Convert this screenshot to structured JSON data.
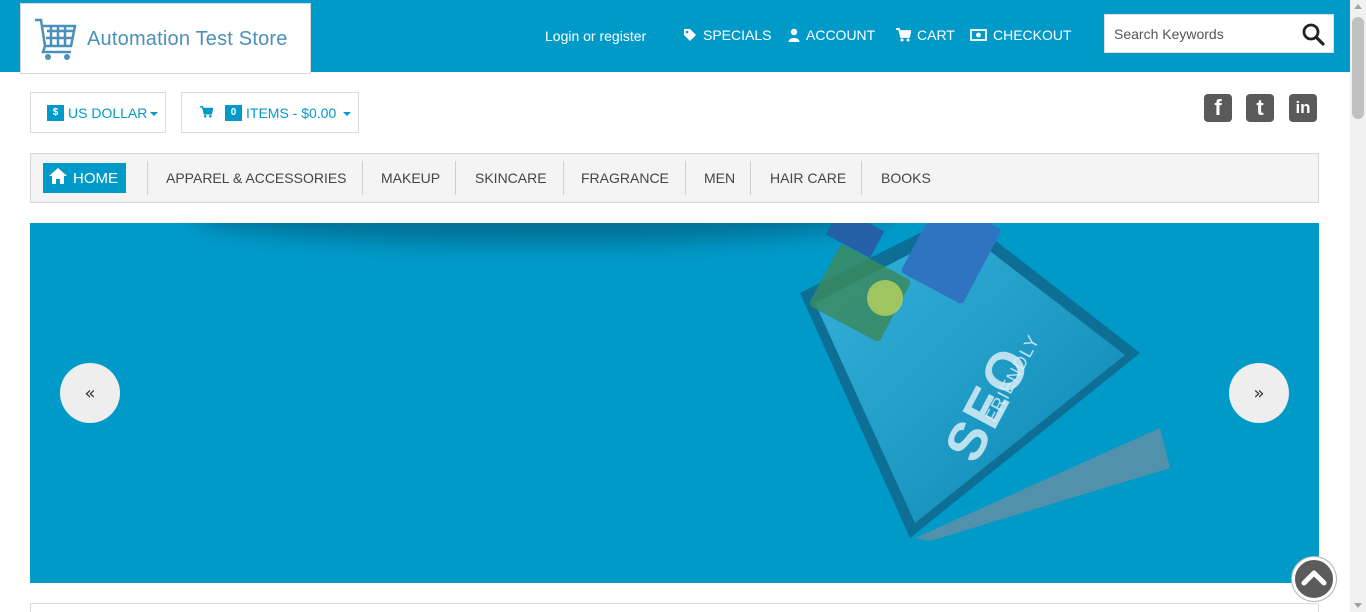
{
  "brand": {
    "name": "Automation Test Store"
  },
  "header": {
    "login_label": "Login or register",
    "nav": [
      {
        "label": "SPECIALS",
        "icon": "tag-icon"
      },
      {
        "label": "ACCOUNT",
        "icon": "user-icon"
      },
      {
        "label": "CART",
        "icon": "cart-icon"
      },
      {
        "label": "CHECKOUT",
        "icon": "money-icon"
      }
    ],
    "search": {
      "placeholder": "Search Keywords",
      "value": "",
      "icon": "search-icon"
    }
  },
  "toolbar": {
    "currency_symbol": "$",
    "currency_label": "US DOLLAR",
    "cart_count": "0",
    "cart_label": "ITEMS - $0.00"
  },
  "social": [
    {
      "name": "facebook",
      "glyph": "f"
    },
    {
      "name": "twitter",
      "glyph": "t"
    },
    {
      "name": "linkedin",
      "glyph": "in"
    }
  ],
  "menu": {
    "home_label": "HOME",
    "items": [
      "APPAREL & ACCESSORIES",
      "MAKEUP",
      "SKINCARE",
      "FRAGRANCE",
      "MEN",
      "HAIR CARE",
      "BOOKS"
    ]
  },
  "banner": {
    "prev_glyph": "«",
    "next_glyph": "»",
    "device_text_main": "SEO",
    "device_text_sub": "FRIENDLY"
  },
  "colors": {
    "accent": "#009ac9",
    "menu_bg": "#f4f4f4",
    "social_bg": "#5a5a5a"
  }
}
